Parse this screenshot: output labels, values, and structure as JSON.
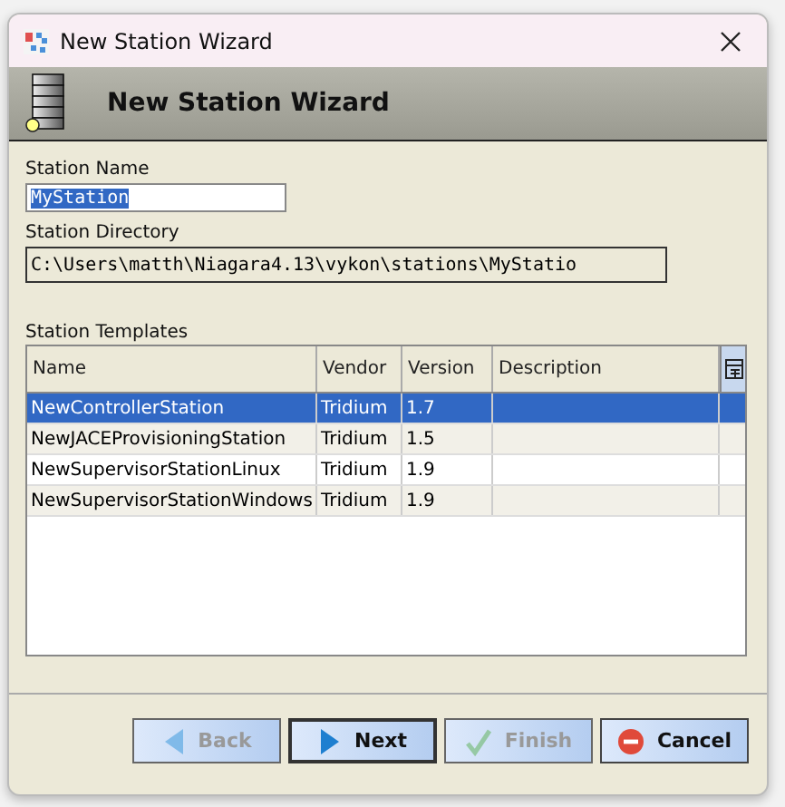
{
  "window": {
    "title": "New Station Wizard"
  },
  "header": {
    "title": "New Station Wizard"
  },
  "fields": [
    {
      "label": "Station Name",
      "value": "MyStation",
      "selected": true,
      "kind": "name"
    },
    {
      "label": "Station Directory",
      "value": "C:\\Users\\matth\\Niagara4.13\\vykon\\stations\\MyStatio",
      "selected": false,
      "kind": "path"
    }
  ],
  "table": {
    "title": "Station Templates",
    "columns": [
      "Name",
      "Vendor",
      "Version",
      "Description"
    ],
    "rows": [
      {
        "cells": [
          "NewControllerStation",
          "Tridium",
          "1.7",
          ""
        ],
        "selected": true
      },
      {
        "cells": [
          "NewJACEProvisioningStation",
          "Tridium",
          "1.5",
          ""
        ],
        "selected": false
      },
      {
        "cells": [
          "NewSupervisorStationLinux",
          "Tridium",
          "1.9",
          ""
        ],
        "selected": false
      },
      {
        "cells": [
          "NewSupervisorStationWindows",
          "Tridium",
          "1.9",
          ""
        ],
        "selected": false
      }
    ]
  },
  "buttons": [
    {
      "label": "Back",
      "kind": "back",
      "disabled": true,
      "default": false
    },
    {
      "label": "Next",
      "kind": "next",
      "disabled": false,
      "default": true
    },
    {
      "label": "Finish",
      "kind": "finish",
      "disabled": true,
      "default": false
    },
    {
      "label": "Cancel",
      "kind": "cancel",
      "disabled": false,
      "default": false
    }
  ]
}
